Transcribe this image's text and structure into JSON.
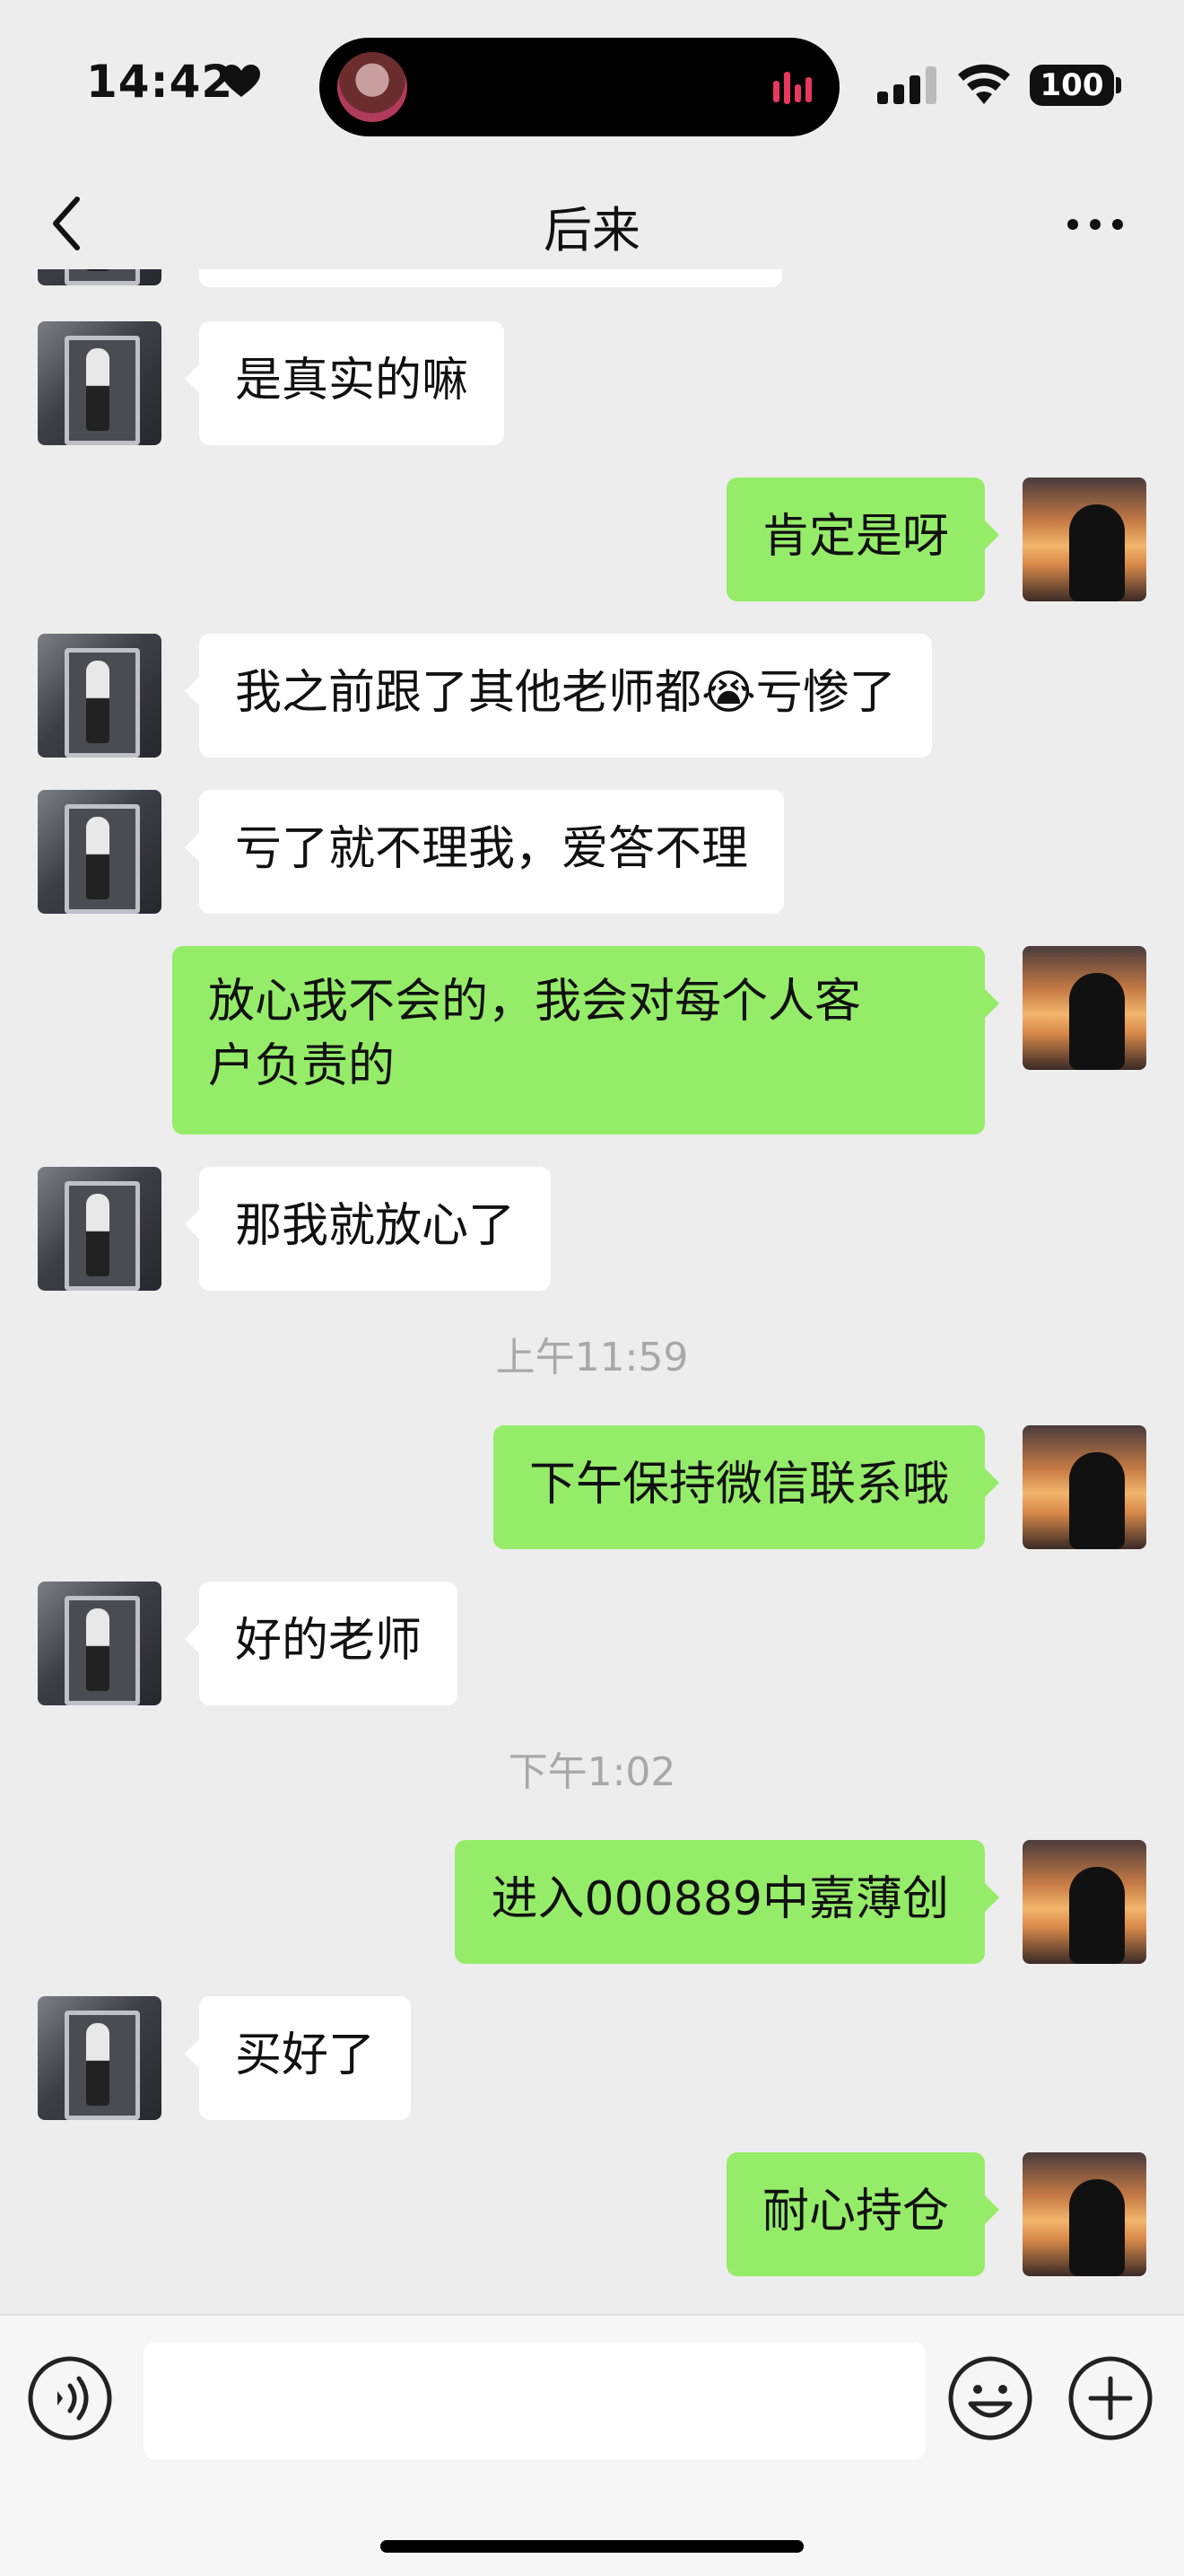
{
  "status_bar": {
    "time": "14:42",
    "battery": "100"
  },
  "nav": {
    "title": "后来"
  },
  "messages": [
    {
      "side": "left",
      "text": "是真实的嘛"
    },
    {
      "side": "right",
      "text": "肯定是呀"
    },
    {
      "side": "left",
      "text": "我之前跟了其他老师都😭亏惨了"
    },
    {
      "side": "left",
      "text": "亏了就不理我，爱答不理"
    },
    {
      "side": "right",
      "text": "放心我不会的，我会对每个人客\n户负责的"
    },
    {
      "side": "left",
      "text": "那我就放心了"
    },
    {
      "side": "right",
      "text": "下午保持微信联系哦"
    },
    {
      "side": "left",
      "text": "好的老师"
    },
    {
      "side": "right",
      "text": "进入000889中嘉薄创"
    },
    {
      "side": "left",
      "text": "买好了"
    },
    {
      "side": "right",
      "text": "耐心持仓"
    }
  ],
  "timestamps": [
    "上午11:59",
    "下午1:02"
  ],
  "colors": {
    "background": "#ededed",
    "bubble_self": "#95ec69",
    "bubble_other": "#ffffff"
  },
  "icons": [
    "back-icon",
    "more-icon",
    "voice-icon",
    "emoji-icon",
    "plus-icon"
  ]
}
